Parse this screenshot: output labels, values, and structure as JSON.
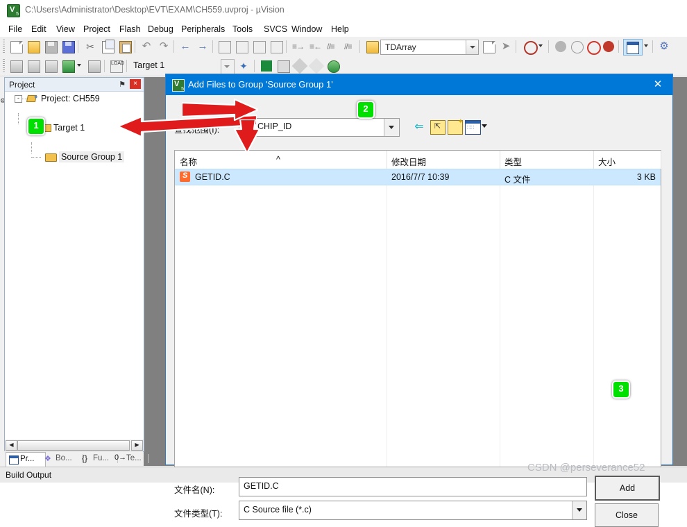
{
  "window": {
    "title": "C:\\Users\\Administrator\\Desktop\\EVT\\EXAM\\CH559.uvproj - µVision",
    "app_icon": "keil-uvision-icon"
  },
  "menubar": {
    "items": [
      {
        "label": "File"
      },
      {
        "label": "Edit"
      },
      {
        "label": "View"
      },
      {
        "label": "Project"
      },
      {
        "label": "Flash"
      },
      {
        "label": "Debug"
      },
      {
        "label": "Peripherals"
      },
      {
        "label": "Tools"
      },
      {
        "label": "SVCS"
      },
      {
        "label": "Window"
      },
      {
        "label": "Help"
      }
    ]
  },
  "toolbar": {
    "target_value": "Target 1",
    "symbol_value": "TDArray"
  },
  "project_panel": {
    "title": "Project",
    "pin_glyph": "⚑",
    "close_glyph": "×",
    "tree": [
      {
        "label": "Project: CH559",
        "expander": "-"
      },
      {
        "label": "Target 1",
        "expander": "-"
      },
      {
        "label": "Source Group 1",
        "expander": ""
      }
    ],
    "tabs": [
      {
        "label": "Pr...",
        "icon": "project-icon"
      },
      {
        "label": "Bo...",
        "icon": "books-icon"
      },
      {
        "label": "Fu...",
        "icon": "functions-icon"
      },
      {
        "label": "Te...",
        "icon": "templates-icon"
      }
    ]
  },
  "dialog": {
    "title": "Add Files to Group 'Source Group 1'",
    "close_glyph": "✕",
    "look_in_label": "查找范围(I):",
    "look_in_value": "CHIP_ID",
    "nav": {
      "back_glyph": "⇐",
      "up_folder": "up-folder-icon",
      "new_folder": "new-folder-icon",
      "views": "views-icon"
    },
    "columns": [
      {
        "label": "名称"
      },
      {
        "label": "修改日期"
      },
      {
        "label": "类型"
      },
      {
        "label": "大小"
      }
    ],
    "sort_indicator": "^",
    "files": [
      {
        "name": "GETID.C",
        "modified": "2016/7/7 10:39",
        "type": "C 文件",
        "size": "3 KB",
        "icon": "sublime-file-icon",
        "selected": true
      }
    ],
    "filename_label": "文件名(N):",
    "filename_value": "GETID.C",
    "filetype_label": "文件类型(T):",
    "filetype_value": "C Source file (*.c)",
    "add_button": "Add",
    "close_button": "Close"
  },
  "status": {
    "build_output": "Build Output"
  },
  "annotations": {
    "badges": [
      {
        "number": "1"
      },
      {
        "number": "2"
      },
      {
        "number": "3"
      }
    ],
    "watermark": "CSDN @perseverance52",
    "accent_color": "#00e000",
    "arrow_color": "#e01b1b",
    "dialog_title_color": "#0078d7",
    "selection_color": "#cce8ff"
  }
}
